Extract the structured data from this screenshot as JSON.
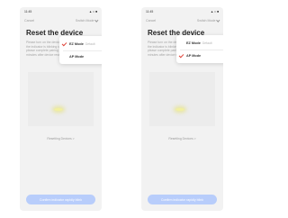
{
  "status_bar": {
    "time": "11:45",
    "icons": "▲ ≈ ■"
  },
  "nav": {
    "cancel": "Cancel",
    "switch_mode": "Switch Mode"
  },
  "screen": {
    "title": "Reset the device",
    "instructions": "Please turn on the device and confirm the indicator is blinking rapidly. Attention: please complete pairing process within 3 minutes after device reset.",
    "status_text": "Resetting Devices >",
    "confirm_button": "Confirm indicator rapidly blink"
  },
  "dropdown": {
    "items": [
      {
        "label": "EZ Mode",
        "suffix": "Default",
        "checked": true
      },
      {
        "label": "AP Mode",
        "suffix": "",
        "checked": false
      }
    ]
  },
  "colors": {
    "accent_check": "#e0453a",
    "button_bg": "#b8cdfb"
  }
}
